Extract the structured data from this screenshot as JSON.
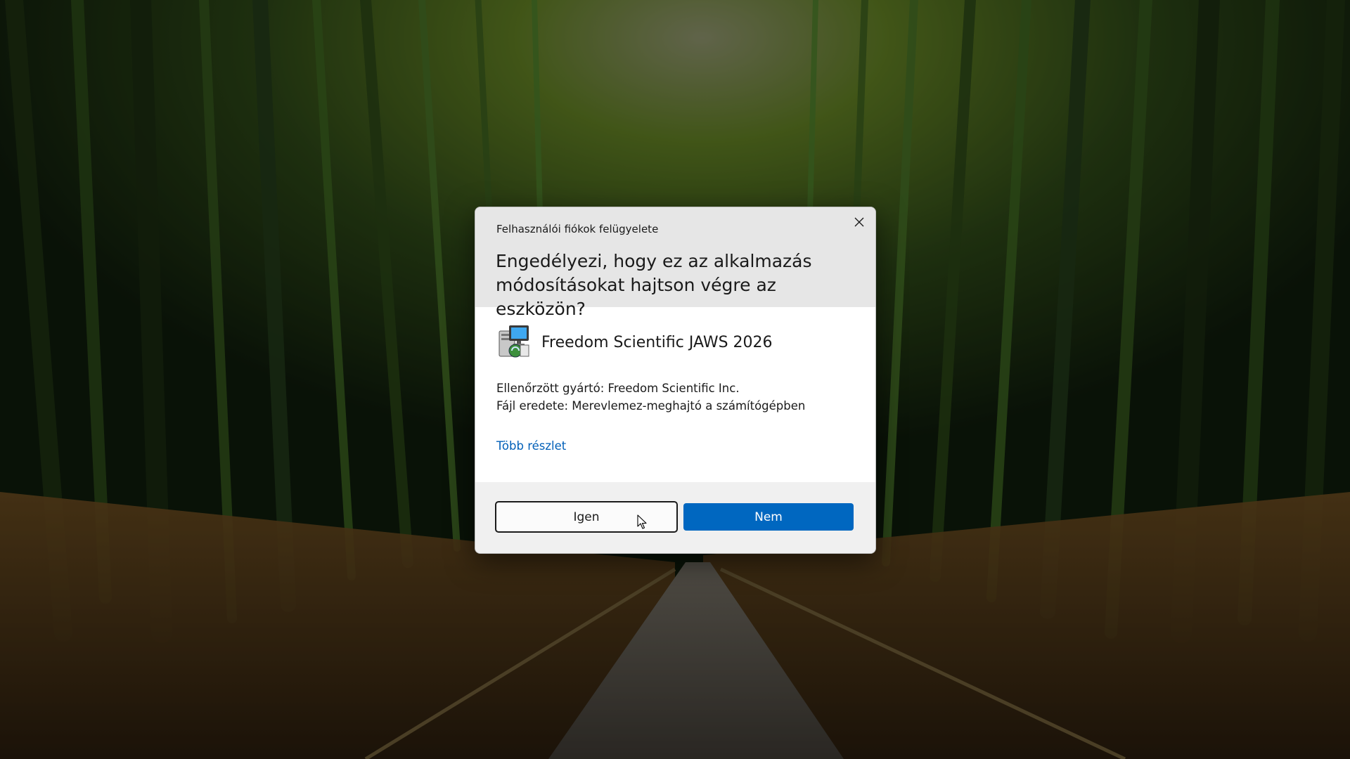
{
  "dialog": {
    "caption": "Felhasználói fiókok felügyelete",
    "question": "Engedélyezi, hogy ez az alkalmazás módosításokat hajtson végre az eszközön?",
    "app_name": "Freedom Scientific JAWS 2026",
    "publisher_line": "Ellenőrzött gyártó: Freedom Scientific Inc.",
    "origin_line": "Fájl eredete: Merevlemez-meghajtó a számítógépben",
    "more_details": "Több részlet",
    "yes_label": "Igen",
    "no_label": "Nem",
    "close_icon": "close-icon",
    "app_icon": "installer-icon"
  },
  "colors": {
    "header_bg": "#e6e6e6",
    "footer_bg": "#f0f0f0",
    "link": "#005fb8",
    "primary_button": "#0067c0"
  },
  "background": {
    "description_icon": "bamboo-forest-wallpaper"
  }
}
